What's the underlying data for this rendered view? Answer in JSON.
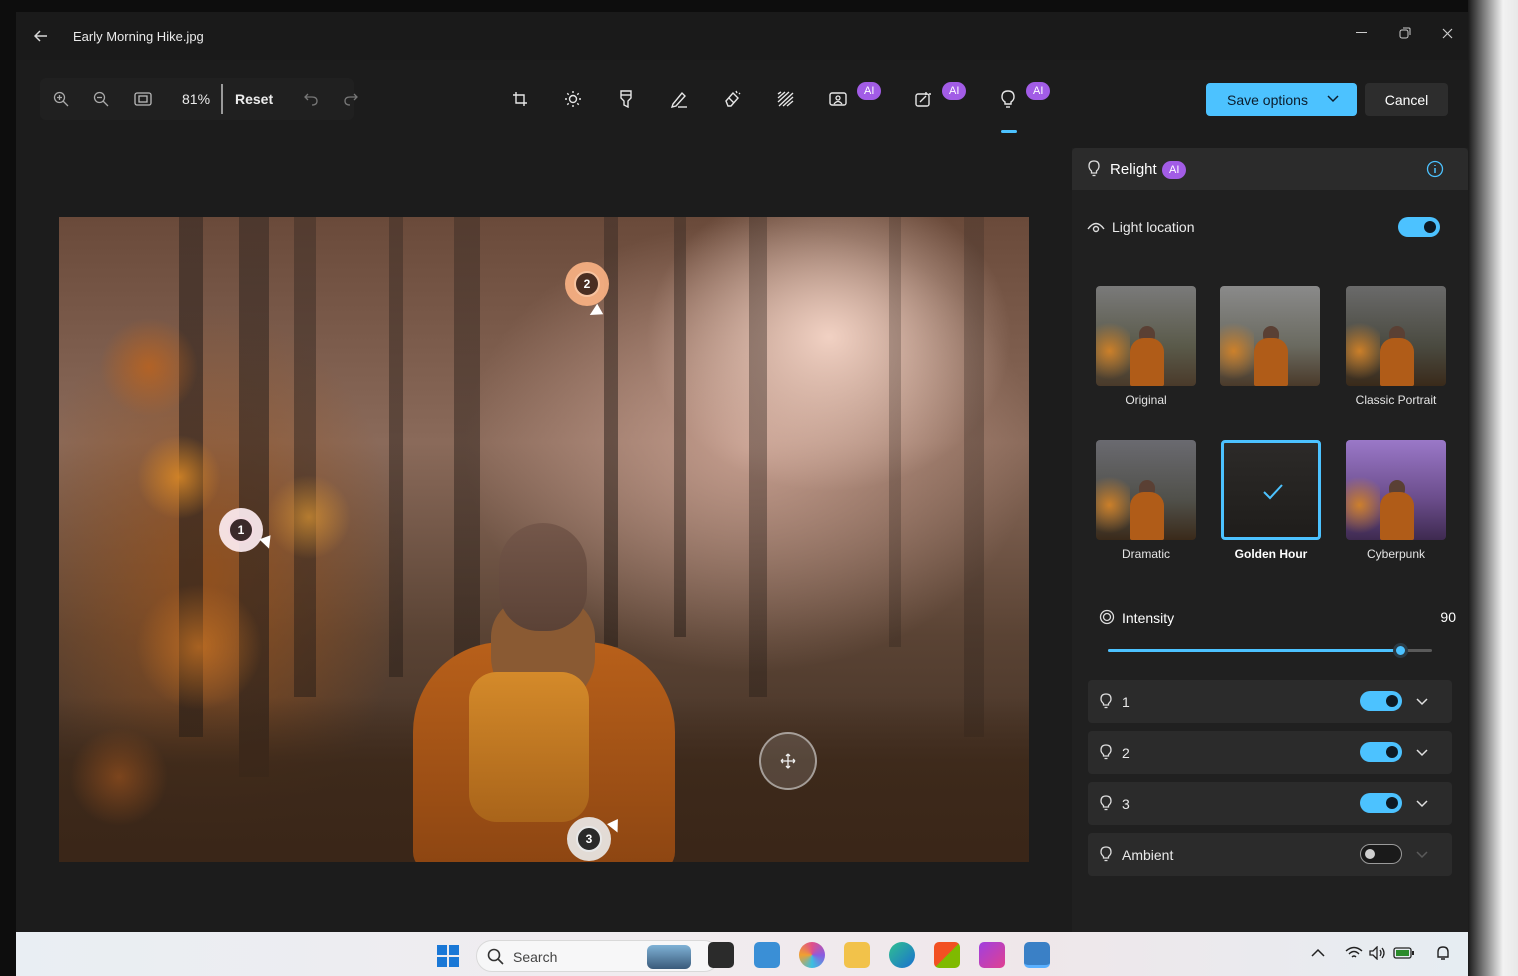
{
  "window": {
    "title": "Early Morning Hike.jpg"
  },
  "toolbar": {
    "zoom_percent": "81%",
    "reset_label": "Reset",
    "ai_badge": "AI",
    "save_label": "Save options",
    "cancel_label": "Cancel",
    "tools": [
      "crop-icon",
      "brightness-icon",
      "filter-icon",
      "markup-icon",
      "erase-icon",
      "blur-icon",
      "background-icon",
      "restyle-icon",
      "relight-icon"
    ]
  },
  "canvas": {
    "lights": [
      {
        "number": "1",
        "color": "#f4dce2"
      },
      {
        "number": "2",
        "color": "#f0a070"
      },
      {
        "number": "3",
        "color": "#e8e8e8"
      }
    ]
  },
  "panel": {
    "title": "Relight",
    "title_badge": "AI",
    "light_location_label": "Light location",
    "light_location_on": true,
    "presets": [
      {
        "label": "Original",
        "selected": false
      },
      {
        "label": "",
        "selected": false
      },
      {
        "label": "Classic Portrait",
        "selected": false
      },
      {
        "label": "Dramatic",
        "selected": false
      },
      {
        "label": "Golden Hour",
        "selected": true
      },
      {
        "label": "Cyberpunk",
        "selected": false
      }
    ],
    "intensity_label": "Intensity",
    "intensity_value": "90",
    "intensity_fraction": 0.9,
    "lights": [
      {
        "label": "1",
        "on": true
      },
      {
        "label": "2",
        "on": true
      },
      {
        "label": "3",
        "on": true
      },
      {
        "label": "Ambient",
        "on": false
      }
    ]
  },
  "taskbar": {
    "search_label": "Search"
  },
  "colors": {
    "accent": "#4cc2ff",
    "ai_badge": "#a25ce6",
    "panel_bg": "#202020",
    "app_bg": "#1c1c1c"
  }
}
